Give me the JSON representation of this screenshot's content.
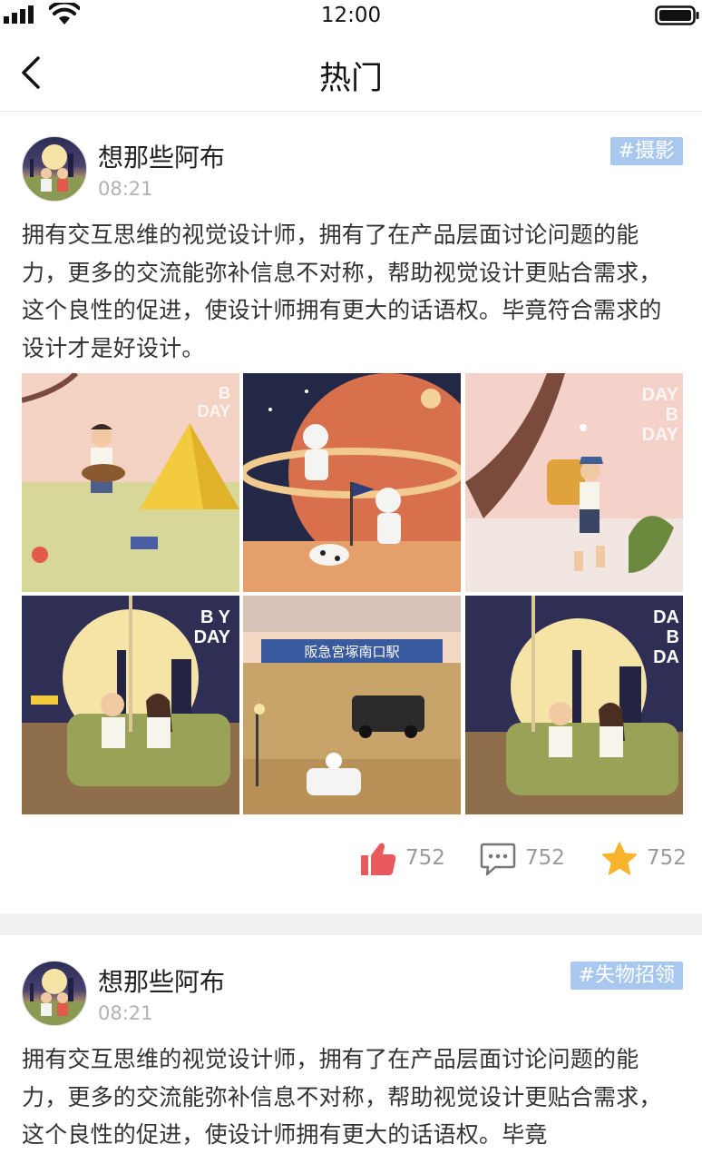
{
  "status_bar": {
    "time": "12:00"
  },
  "nav": {
    "title": "热门"
  },
  "posts": [
    {
      "author": "想那些阿布",
      "time": "08:21",
      "tag": "#摄影",
      "content": "拥有交互思维的视觉设计师，拥有了在产品层面讨论问题的能力，更多的交流能弥补信息不对称，帮助视觉设计更贴合需求，这个良性的促进，使设计师拥有更大的话语权。毕竟符合需求的设计才是好设计。",
      "image_texts": {
        "img1": "B\nDAY",
        "img3": "DAY\nB\nDAY",
        "img4": "B Y\nDAY",
        "img5": "阪急宮塚南口駅",
        "img6": "DA\nB\nDA"
      },
      "likes": "752",
      "comments": "752",
      "favorites": "752"
    },
    {
      "author": "想那些阿布",
      "time": "08:21",
      "tag": "#失物招领",
      "content": "拥有交互思维的视觉设计师，拥有了在产品层面讨论问题的能力，更多的交流能弥补信息不对称，帮助视觉设计更贴合需求，这个良性的促进，使设计师拥有更大的话语权。毕竟"
    }
  ],
  "colors": {
    "tag_bg": "#a8c8ef",
    "like": "#e8595c",
    "star": "#f7b42c",
    "divider": "#f1f1f1"
  },
  "icons": [
    "signal-icon",
    "wifi-icon",
    "battery-icon",
    "back-arrow-icon",
    "thumbs-up-icon",
    "comment-icon",
    "star-icon"
  ]
}
